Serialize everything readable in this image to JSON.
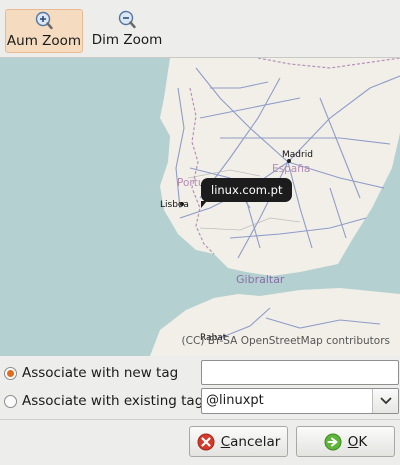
{
  "toolbar": {
    "zoom_in_label": "Aum Zoom",
    "zoom_out_label": "Dim Zoom"
  },
  "map": {
    "marker_label": "linux.com.pt",
    "cities": [
      "Madrid",
      "Lisboa",
      "Rabat"
    ],
    "regions": [
      "Portugal",
      "España",
      "Gibraltar"
    ],
    "attribution": "(CC) BY-SA OpenStreetMap contributors"
  },
  "options": {
    "new_tag_label": "Associate with new tag",
    "new_tag_value": "",
    "new_tag_selected": true,
    "existing_tag_label": "Associate with existing tag",
    "existing_tag_value": "@linuxpt"
  },
  "buttons": {
    "cancel_first": "C",
    "cancel_rest": "ancelar",
    "ok_first": "O",
    "ok_rest": "K"
  },
  "colors": {
    "accent": "#e06c20",
    "active_bg": "#f5dcc0",
    "sea": "#b5d0d0",
    "land": "#f2efe9"
  }
}
